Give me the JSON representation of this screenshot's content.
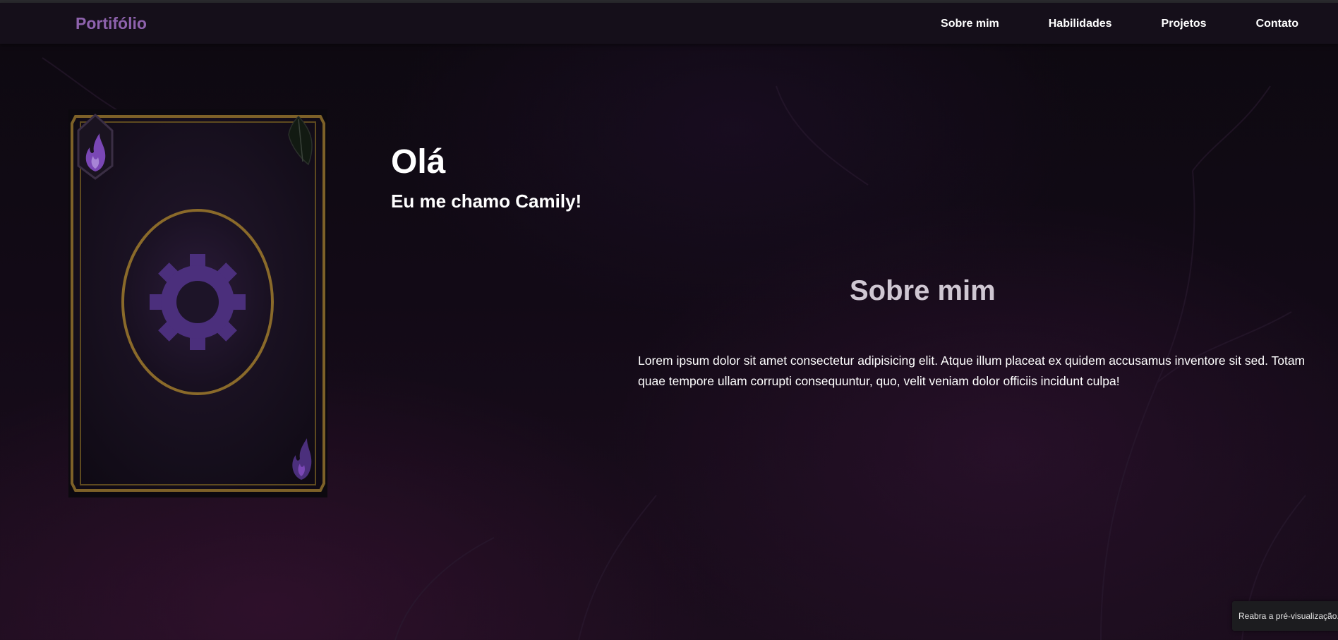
{
  "nav": {
    "brand": "Portifólio",
    "links": [
      "Sobre mim",
      "Habilidades",
      "Projetos",
      "Contato"
    ]
  },
  "hero": {
    "greeting": "Olá",
    "intro": "Eu me chamo Camily!"
  },
  "about": {
    "title": "Sobre mim",
    "text": "Lorem ipsum dolor sit amet consectetur adipisicing elit. Atque illum placeat ex quidem accusamus inventore sit sed. Totam quae tempore ullam corrupti consequuntur, quo, velit veniam dolor officiis incidunt culpa!"
  },
  "card": {
    "center_icon": "gear-icon",
    "corner_icons": [
      "purple-flame-icon",
      "dark-leaf-icon",
      "purple-flame-icon"
    ]
  },
  "toast": {
    "label": "Reabra a pré-visualização."
  },
  "colors": {
    "brand": "#8e62ad",
    "card_gold": "#8a6a2a",
    "gear_purple": "#4b2f7c",
    "flame_purple": "#7a47b5",
    "navbar_bg": "#150f1a"
  }
}
